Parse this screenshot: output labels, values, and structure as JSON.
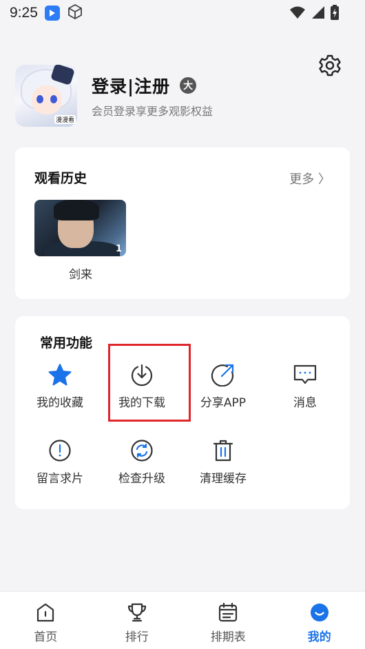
{
  "status_bar": {
    "time": "9:25",
    "icons": [
      "app-icon",
      "cube-icon",
      "wifi-icon",
      "signal-icon",
      "battery-charging-icon"
    ]
  },
  "profile": {
    "title": "登录|注册",
    "badge": "大",
    "subtitle": "会员登录享更多观影权益",
    "avatar_tag": "漫漫看"
  },
  "history": {
    "title": "观看历史",
    "more": "更多 〉",
    "items": [
      {
        "title": "剑来",
        "episode": "1"
      }
    ]
  },
  "functions": {
    "title": "常用功能",
    "items": [
      {
        "label": "我的收藏",
        "icon": "star-icon"
      },
      {
        "label": "我的下载",
        "icon": "download-icon"
      },
      {
        "label": "分享APP",
        "icon": "share-icon"
      },
      {
        "label": "消息",
        "icon": "message-icon"
      },
      {
        "label": "留言求片",
        "icon": "feedback-icon"
      },
      {
        "label": "检查升级",
        "icon": "refresh-icon"
      },
      {
        "label": "清理缓存",
        "icon": "trash-icon"
      }
    ]
  },
  "tabbar": {
    "tabs": [
      {
        "label": "首页",
        "icon": "home-icon"
      },
      {
        "label": "排行",
        "icon": "trophy-icon"
      },
      {
        "label": "排期表",
        "icon": "calendar-icon"
      },
      {
        "label": "我的",
        "icon": "profile-icon"
      }
    ],
    "active_index": 3
  },
  "colors": {
    "accent": "#1a73e8",
    "star": "#1a73e8",
    "highlight_border": "#e0252b",
    "background": "#f4f4f6"
  }
}
